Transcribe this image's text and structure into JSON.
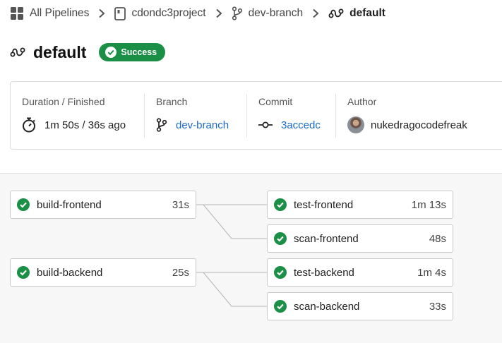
{
  "breadcrumb": {
    "all_pipelines": "All Pipelines",
    "project": "cdondc3project",
    "branch": "dev-branch",
    "pipeline": "default"
  },
  "header": {
    "title": "default",
    "status": "Success"
  },
  "info": {
    "duration_label": "Duration / Finished",
    "duration_value": "1m 50s / 36s ago",
    "branch_label": "Branch",
    "branch_value": "dev-branch",
    "commit_label": "Commit",
    "commit_value": "3accedc",
    "author_label": "Author",
    "author_value": "nukedragocodefreak"
  },
  "jobs": {
    "build_frontend": {
      "name": "build-frontend",
      "duration": "31s",
      "status": "success"
    },
    "build_backend": {
      "name": "build-backend",
      "duration": "25s",
      "status": "success"
    },
    "test_frontend": {
      "name": "test-frontend",
      "duration": "1m 13s",
      "status": "success"
    },
    "scan_frontend": {
      "name": "scan-frontend",
      "duration": "48s",
      "status": "success"
    },
    "test_backend": {
      "name": "test-backend",
      "duration": "1m 4s",
      "status": "success"
    },
    "scan_backend": {
      "name": "scan-backend",
      "duration": "33s",
      "status": "success"
    }
  },
  "colors": {
    "success": "#1a8f45",
    "link": "#1b6ac9",
    "connector": "#b5b5b5"
  },
  "icons": {
    "apps": "grid-icon",
    "project": "repo-icon",
    "branch": "git-branch-icon",
    "pipeline": "pipeline-icon",
    "status": "check-circle-icon",
    "timer": "stopwatch-icon",
    "commit": "git-commit-icon"
  }
}
